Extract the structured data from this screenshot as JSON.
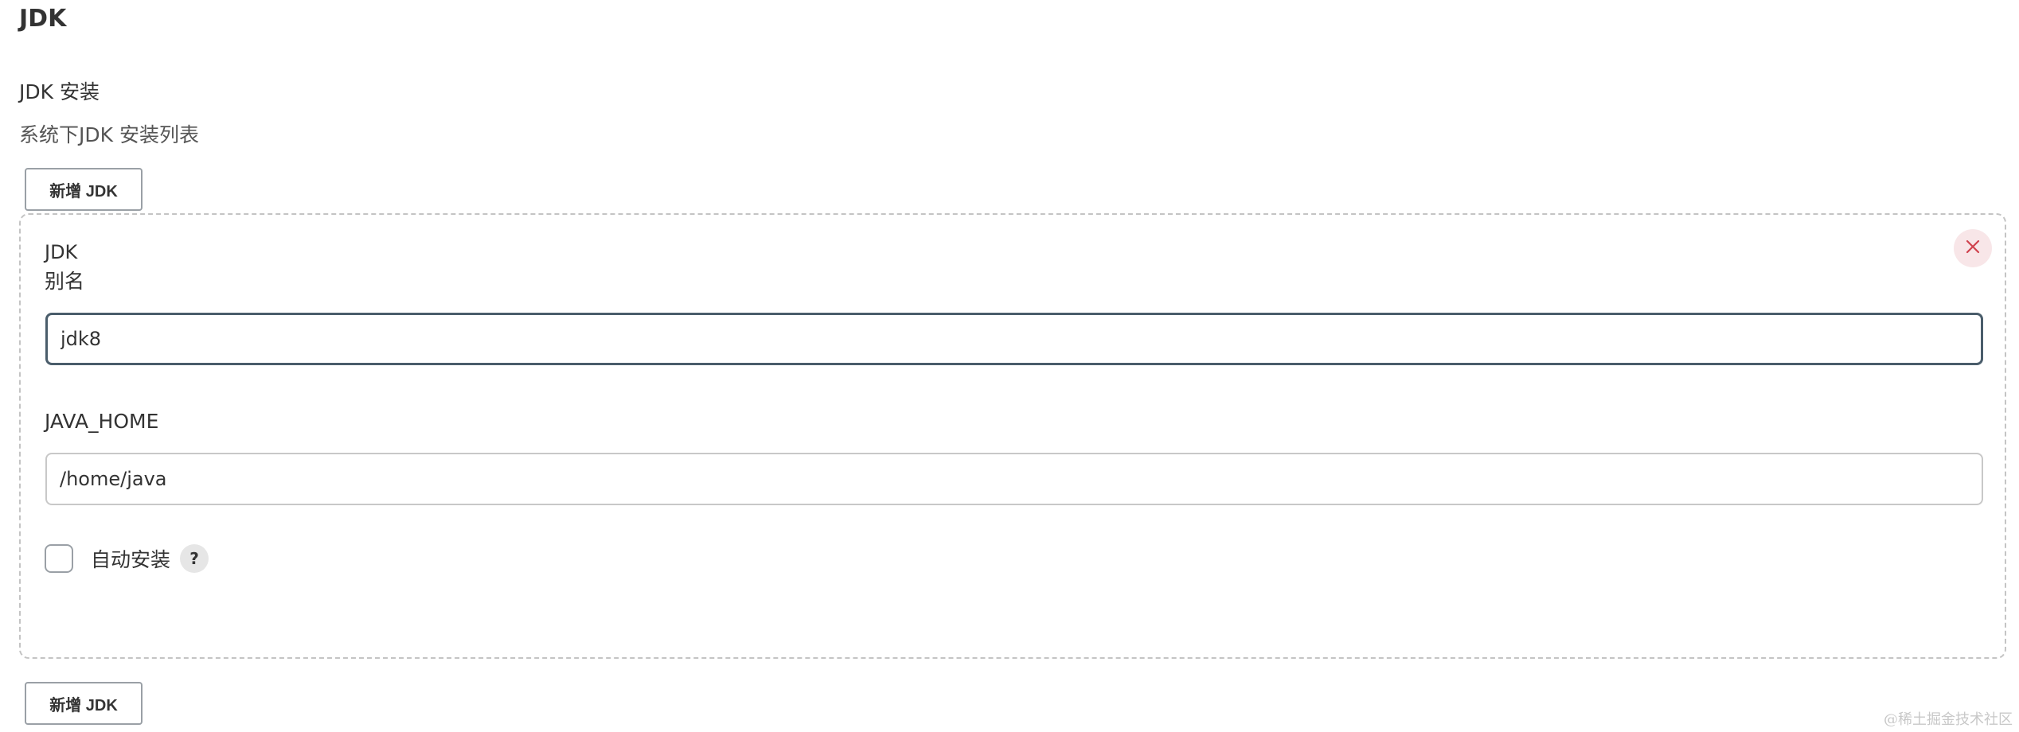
{
  "section": {
    "title": "JDK"
  },
  "installations": {
    "title": "JDK 安装",
    "description": "系统下JDK 安装列表",
    "add_button_label": "新增 JDK"
  },
  "jdk_entry": {
    "kind_label": "JDK",
    "alias_label": "别名",
    "alias_value": "jdk8",
    "java_home_label": "JAVA_HOME",
    "java_home_value": "/home/java",
    "auto_install_label": "自动安装",
    "auto_install_checked": false,
    "help_glyph": "?",
    "close_icon": "close-icon"
  },
  "colors": {
    "close_icon": "#d0424d",
    "close_bg": "#f8e6e8",
    "focus_border": "#4a5d6b"
  },
  "watermark": "@稀土掘金技术社区"
}
